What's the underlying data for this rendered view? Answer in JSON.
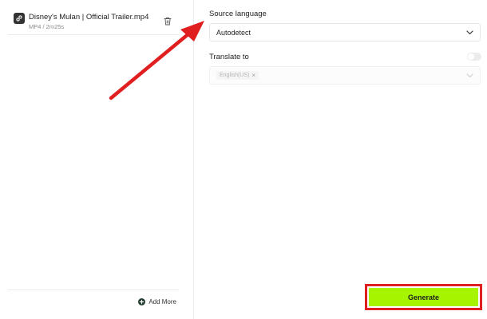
{
  "file": {
    "name": "Disney's Mulan | Official Trailer.mp4",
    "meta": "MP4 / 2m25s",
    "icon": "link-icon"
  },
  "left_footer": {
    "add_more_label": "Add More"
  },
  "source_language": {
    "label": "Source language",
    "value": "Autodetect"
  },
  "translate_to": {
    "label": "Translate to",
    "enabled": false,
    "selected_chip": "English(US)"
  },
  "generate": {
    "label": "Generate",
    "color": "#a6f400"
  },
  "annotations": {
    "highlight_color": "#e02020"
  }
}
